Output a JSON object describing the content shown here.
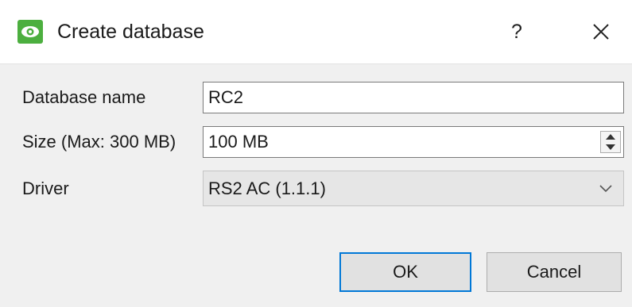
{
  "window": {
    "title": "Create database",
    "help_label": "?",
    "icon": "eye-app-icon",
    "close_icon": "close-icon",
    "accent_color": "#4caf3f"
  },
  "form": {
    "name_label": "Database name",
    "name_value": "RC2",
    "size_label": "Size (Max: 300 MB)",
    "size_value": "100 MB",
    "driver_label": "Driver",
    "driver_value": "RS2 AC (1.1.1)"
  },
  "buttons": {
    "ok_label": "OK",
    "cancel_label": "Cancel",
    "focus_color": "#0078d7"
  }
}
